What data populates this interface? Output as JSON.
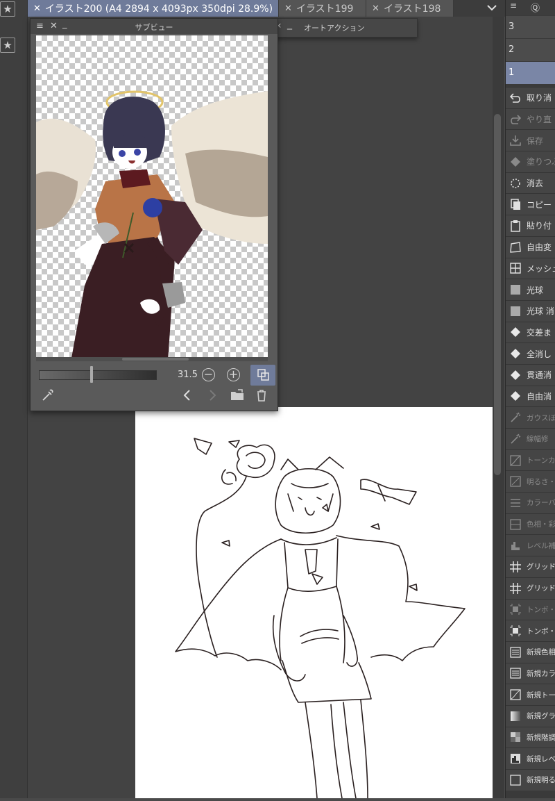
{
  "tabs": [
    {
      "label": "イラスト200 (A4 2894 x 4093px 350dpi 28.9%)",
      "active": true
    },
    {
      "label": "イラスト199",
      "active": false
    },
    {
      "label": "イラスト198",
      "active": false
    }
  ],
  "subview": {
    "title": "サブビュー",
    "zoom_value": "31.5",
    "zoom_level": 0.44
  },
  "auto_action": {
    "title": "オートアクション"
  },
  "right_panel": {
    "layers": [
      "3",
      "2",
      "1"
    ],
    "commands": [
      {
        "label": "取り消",
        "icon": "undo-icon",
        "enabled": true
      },
      {
        "label": "やり直",
        "icon": "redo-icon",
        "enabled": false
      },
      {
        "label": "保存",
        "icon": "save-icon",
        "enabled": false
      },
      {
        "label": "塗りつぶ",
        "icon": "fill-icon",
        "enabled": false
      },
      {
        "label": "消去",
        "icon": "clear-icon",
        "enabled": true
      },
      {
        "label": "コピー",
        "icon": "copy-icon",
        "enabled": true
      },
      {
        "label": "貼り付",
        "icon": "paste-icon",
        "enabled": true
      },
      {
        "label": "自由変",
        "icon": "free-transform-icon",
        "enabled": true
      },
      {
        "label": "メッシュ",
        "icon": "mesh-transform-icon",
        "enabled": true
      },
      {
        "label": "光球",
        "icon": "light-ball-icon",
        "enabled": true
      },
      {
        "label": "光球 消",
        "icon": "light-ball-icon",
        "enabled": true
      },
      {
        "label": "交差ま",
        "icon": "eraser-icon",
        "enabled": true
      },
      {
        "label": "全消し",
        "icon": "eraser-icon",
        "enabled": true
      },
      {
        "label": "貫通消",
        "icon": "eraser-icon",
        "enabled": true
      },
      {
        "label": "自由消",
        "icon": "eraser-icon",
        "enabled": true
      },
      {
        "label": "ガウスぼ",
        "icon": "magic-wand-icon",
        "enabled": false
      },
      {
        "label": "線幅修",
        "icon": "magic-wand-icon",
        "enabled": false
      },
      {
        "label": "トーンカ",
        "icon": "tone-curve-icon",
        "enabled": false
      },
      {
        "label": "明るさ・",
        "icon": "brightness-icon",
        "enabled": false
      },
      {
        "label": "カラーバ",
        "icon": "color-balance-icon",
        "enabled": false
      },
      {
        "label": "色相・彩",
        "icon": "hue-icon",
        "enabled": false
      },
      {
        "label": "レベル補",
        "icon": "levels-icon",
        "enabled": false
      },
      {
        "label": "グリッド",
        "icon": "grid-icon",
        "enabled": true
      },
      {
        "label": "グリッド",
        "icon": "grid-icon",
        "enabled": true
      },
      {
        "label": "トンボ・",
        "icon": "crop-mark-icon",
        "enabled": false
      },
      {
        "label": "トンボ・",
        "icon": "crop-mark-icon",
        "enabled": true
      },
      {
        "label": "新規色相",
        "icon": "new-adjust-layer-icon",
        "enabled": true
      },
      {
        "label": "新規カラ",
        "icon": "new-adjust-layer-icon",
        "enabled": true
      },
      {
        "label": "新規トー",
        "icon": "new-tone-curve-icon",
        "enabled": true
      },
      {
        "label": "新規グラ",
        "icon": "new-gradient-icon",
        "enabled": true
      },
      {
        "label": "新規階調",
        "icon": "new-posterize-icon",
        "enabled": true
      },
      {
        "label": "新規レベ",
        "icon": "new-levels-icon",
        "enabled": true
      },
      {
        "label": "新規明る",
        "icon": "new-brightness-icon",
        "enabled": true
      }
    ]
  },
  "colors": {
    "accent": "#6f7b9a",
    "layer_selected": "#7a86a6",
    "panel_bg": "#3a3a3a",
    "canvas_bg": "#434343"
  }
}
